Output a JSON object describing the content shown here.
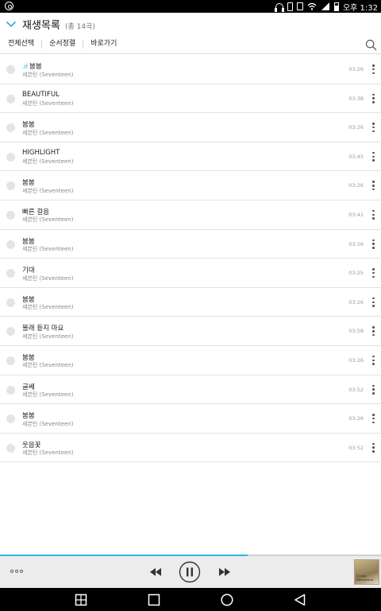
{
  "status_bar": {
    "time": "오후 1:32",
    "icons": [
      "app-icon",
      "headset-icon",
      "phone-icon",
      "note-icon",
      "wifi-icon",
      "signal-icon",
      "battery-icon"
    ]
  },
  "header": {
    "title": "재생목록",
    "count": "(총 14곡)"
  },
  "toolbar": {
    "select_all": "전체선택",
    "sort": "순서정렬",
    "goto": "바로가기"
  },
  "playlist": [
    {
      "title": "붐붐",
      "artist": "세븐틴 (Seventeen)",
      "duration": "03:26",
      "playing": true,
      "playing_indicator": ".ıl"
    },
    {
      "title": "BEAUTIFUL",
      "artist": "세븐틴 (Seventeen)",
      "duration": "03:38"
    },
    {
      "title": "붐붐",
      "artist": "세븐틴 (Seventeen)",
      "duration": "03:26"
    },
    {
      "title": "HIGHLIGHT",
      "artist": "세븐틴 (Seventeen)",
      "duration": "03:45"
    },
    {
      "title": "붐붐",
      "artist": "세븐틴 (Seventeen)",
      "duration": "03:26"
    },
    {
      "title": "빠른 걸음",
      "artist": "세븐틴 (Seventeen)",
      "duration": "03:41"
    },
    {
      "title": "붐붐",
      "artist": "세븐틴 (Seventeen)",
      "duration": "03:26"
    },
    {
      "title": "기대",
      "artist": "세븐틴 (Seventeen)",
      "duration": "03:25"
    },
    {
      "title": "붐붐",
      "artist": "세븐틴 (Seventeen)",
      "duration": "03:26"
    },
    {
      "title": "몰래 듣지 마요",
      "artist": "세븐틴 (Seventeen)",
      "duration": "03:58"
    },
    {
      "title": "붐붐",
      "artist": "세븐틴 (Seventeen)",
      "duration": "03:26"
    },
    {
      "title": "글쎄",
      "artist": "세븐틴 (Seventeen)",
      "duration": "03:52"
    },
    {
      "title": "붐붐",
      "artist": "세븐틴 (Seventeen)",
      "duration": "03:26"
    },
    {
      "title": "웃음꽃",
      "artist": "세븐틴 (Seventeen)",
      "duration": "03:52"
    }
  ],
  "player": {
    "progress_fraction": 0.65,
    "accent_color": "#2ab7e4",
    "album_art_text": "Going Seventeen",
    "controls": [
      "menu-icon",
      "previous-icon",
      "pause-icon",
      "next-icon"
    ]
  },
  "nav_bar": {
    "buttons": [
      "multiwindow-icon",
      "recent-apps-icon",
      "home-icon",
      "back-icon"
    ]
  }
}
